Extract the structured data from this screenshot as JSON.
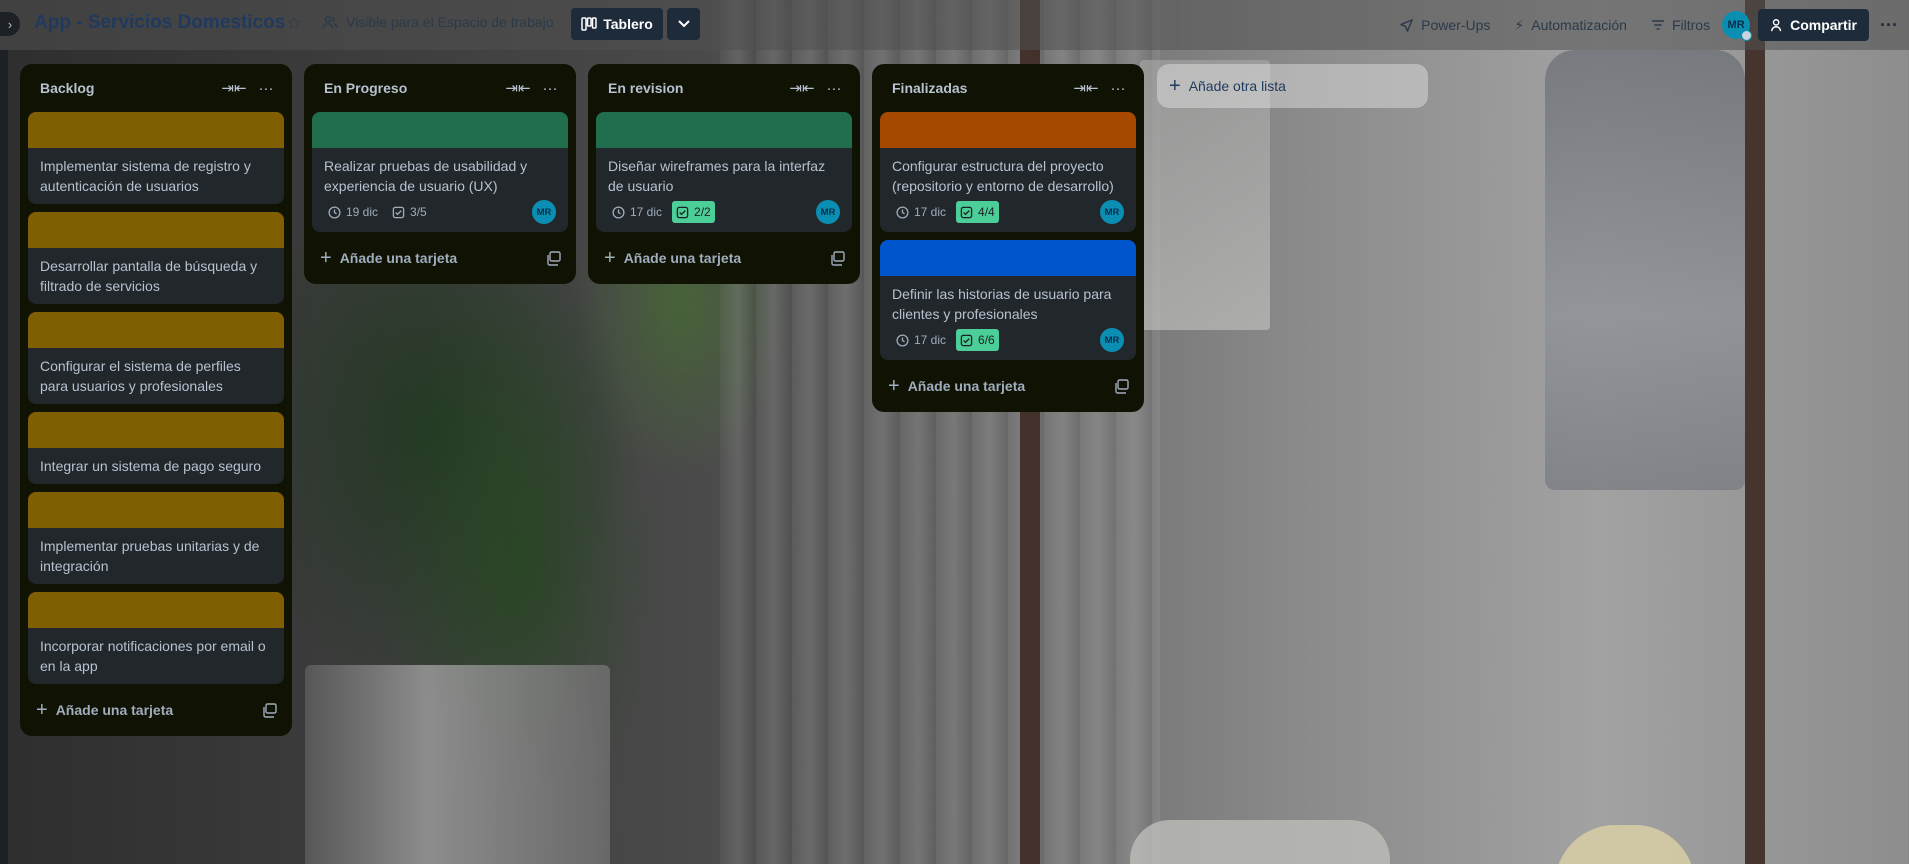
{
  "header": {
    "board_title": "App - Servicios Domesticos",
    "visibility_label": "Visible para el Espacio de trabajo",
    "view_label": "Tablero",
    "powerups_label": "Power-Ups",
    "automation_label": "Automatización",
    "filters_label": "Filtros",
    "share_label": "Compartir",
    "user_initials": "MR"
  },
  "colors": {
    "yellow_cover": "#7f5f01",
    "green_cover": "#216e4e",
    "orange_cover": "#a54800",
    "blue_cover": "#0055cc",
    "done_badge": "#4bce97"
  },
  "lists": [
    {
      "title": "Backlog",
      "add_card_label": "Añade una tarjeta",
      "cards": [
        {
          "title": "Implementar sistema de registro y autenticación de usuarios",
          "cover": "yellow"
        },
        {
          "title": "Desarrollar pantalla de búsqueda y filtrado de servicios",
          "cover": "yellow"
        },
        {
          "title": "Configurar el sistema de perfiles para usuarios y profesionales",
          "cover": "yellow"
        },
        {
          "title": "Integrar un sistema de pago seguro",
          "cover": "yellow"
        },
        {
          "title": "Implementar pruebas unitarias y de integración",
          "cover": "yellow"
        },
        {
          "title": "Incorporar notificaciones por email o en la app",
          "cover": "yellow"
        }
      ]
    },
    {
      "title": "En Progreso",
      "add_card_label": "Añade una tarjeta",
      "cards": [
        {
          "title": "Realizar pruebas de usabilidad y experiencia de usuario (UX)",
          "cover": "green",
          "due": "19 dic",
          "checklist": "3/5",
          "checklist_done": false,
          "member": "MR"
        }
      ]
    },
    {
      "title": "En revision",
      "add_card_label": "Añade una tarjeta",
      "cards": [
        {
          "title": "Diseñar wireframes para la interfaz de usuario",
          "cover": "green",
          "due": "17 dic",
          "checklist": "2/2",
          "checklist_done": true,
          "member": "MR"
        }
      ]
    },
    {
      "title": "Finalizadas",
      "add_card_label": "Añade una tarjeta",
      "cards": [
        {
          "title": "Configurar estructura del proyecto (repositorio y entorno de desarrollo)",
          "cover": "orange",
          "due": "17 dic",
          "checklist": "4/4",
          "checklist_done": true,
          "member": "MR"
        },
        {
          "title": "Definir las historias de usuario para clientes y profesionales",
          "cover": "blue",
          "due": "17 dic",
          "checklist": "6/6",
          "checklist_done": true,
          "member": "MR"
        }
      ]
    }
  ],
  "add_list_label": "Añade otra lista"
}
